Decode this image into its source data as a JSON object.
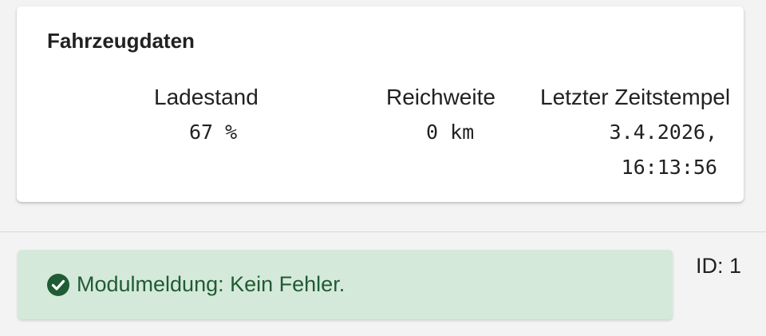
{
  "vehicle_card": {
    "title": "Fahrzeugdaten",
    "charge": {
      "label": "Ladestand",
      "value": "67 %"
    },
    "range": {
      "label": "Reichweite",
      "value": "0 km"
    },
    "timestamp": {
      "label": "Letzter Zeitstempel",
      "date": "3.4.2026,",
      "time": "16:13:56"
    }
  },
  "status_alert": {
    "icon": "check-circle-icon",
    "message": "Modulmeldung: Kein Fehler.",
    "color": "#1f5c33",
    "background": "#d5e9db"
  },
  "module_id": "ID: 1"
}
